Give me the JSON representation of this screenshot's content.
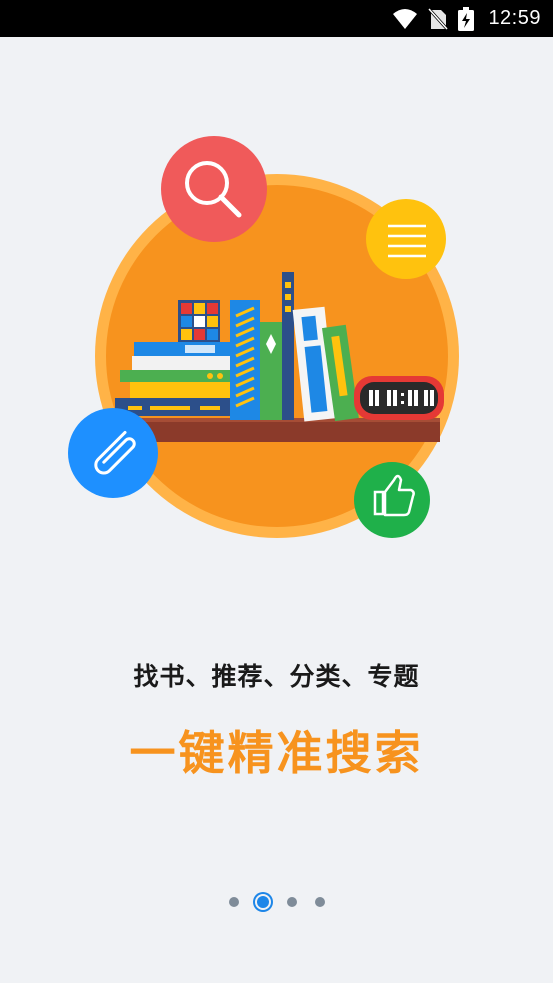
{
  "status_bar": {
    "time": "12:59",
    "icons": [
      "wifi-icon",
      "no-sim-icon",
      "battery-charging-icon"
    ]
  },
  "illustration": {
    "icons": [
      "search-icon",
      "list-icon",
      "paperclip-icon",
      "thumbs-up-icon",
      "bookshelf-illustration"
    ],
    "colors": {
      "orange": "#f7931e",
      "search_circle": "#f05a5a",
      "list_circle": "#ffc20e",
      "clip_circle": "#1e90ff",
      "like_circle": "#1fb04a"
    }
  },
  "caption": {
    "subtitle": "找书、推荐、分类、专题",
    "title": "一键精准搜索"
  },
  "pager": {
    "pages": 4,
    "active_index": 1
  }
}
